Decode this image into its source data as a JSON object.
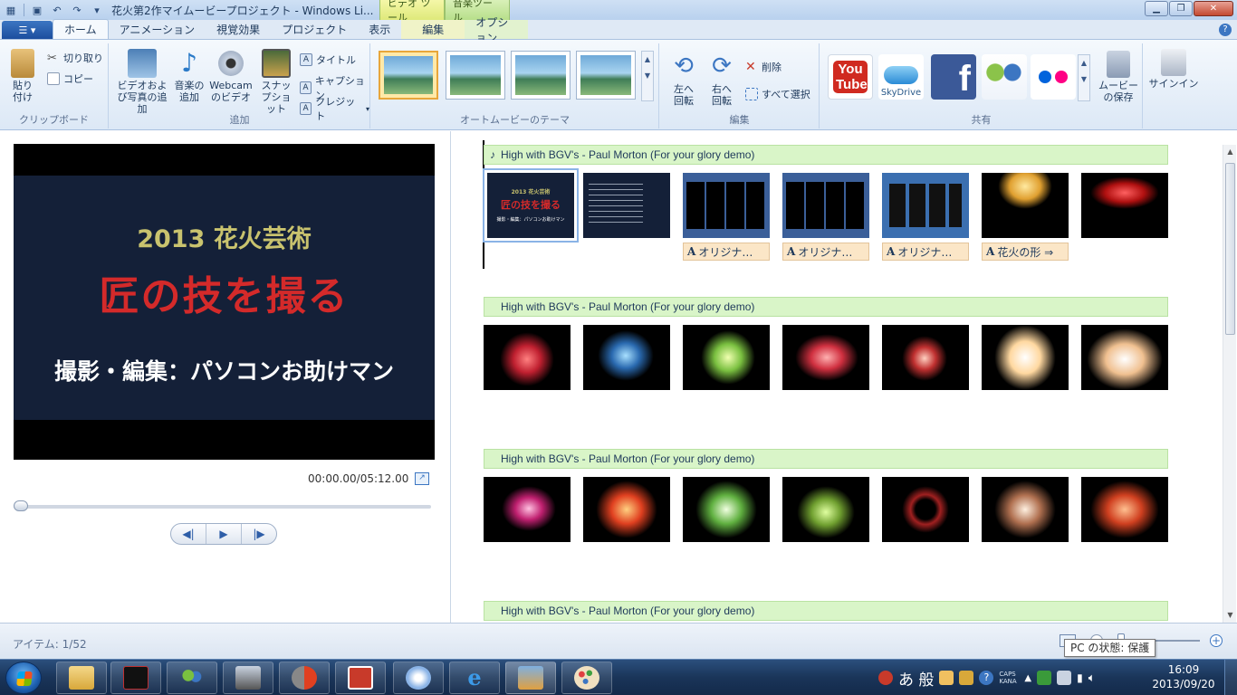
{
  "window": {
    "title": "花火第2作マイムービープロジェクト - Windows Li...",
    "context_tabs": {
      "video_tools": "ビデオ ツール",
      "music_tools": "音楽ツール"
    },
    "controls": {
      "minimize": "▁",
      "maximize": "❐",
      "close": "✕"
    }
  },
  "tabs": {
    "file_label": "▾",
    "items": [
      "ホーム",
      "アニメーション",
      "視覚効果",
      "プロジェクト",
      "表示"
    ],
    "edit": "編集",
    "options": "オプション",
    "help": "?"
  },
  "ribbon": {
    "clipboard": {
      "label": "クリップボード",
      "paste": "貼り付け",
      "cut": "切り取り",
      "copy": "コピー"
    },
    "add": {
      "label": "追加",
      "video_photo": "ビデオおよび写真の追加",
      "music": "音楽の追加",
      "webcam": "Webcamのビデオ",
      "snapshot": "スナップショット",
      "title": "タイトル",
      "caption": "キャプション",
      "credit": "クレジット"
    },
    "themes": {
      "label": "オートムービーのテーマ"
    },
    "edit": {
      "label": "編集",
      "rotate_left": "左へ回転",
      "rotate_right": "右へ回転",
      "delete": "削除",
      "select_all": "すべて選択"
    },
    "share": {
      "label": "共有",
      "youtube": "You Tube",
      "skydrive": "SkyDrive",
      "facebook": "f",
      "save_movie": "ムービーの保存"
    },
    "signin": "サインイン"
  },
  "preview": {
    "slide_year": "2013 花火芸術",
    "slide_main": "匠の技を撮る",
    "slide_credit": "撮影・編集：パソコンお助けマン",
    "timecode": "00:00.00/05:12.00"
  },
  "storyboard": {
    "music_track": "High with BGV's - Paul Morton (For your glory demo)",
    "music_note": "♪",
    "captions": [
      "オリジナ…",
      "オリジナ…",
      "オリジナ…",
      "花火の形 ⇒"
    ]
  },
  "status": {
    "items": "アイテム: 1/52",
    "tooltip": "PC の状態: 保護"
  },
  "taskbar": {
    "ime_mode": "あ 般",
    "caps": "CAPS KANA",
    "time": "16:09",
    "date": "2013/09/20"
  }
}
